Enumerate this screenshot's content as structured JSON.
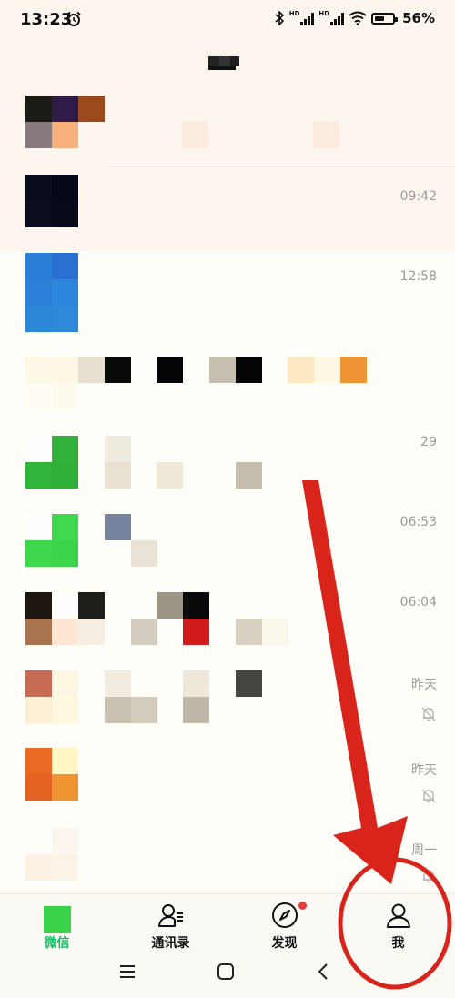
{
  "status_bar": {
    "time": "13:23",
    "alarm_icon": "alarm-clock-icon",
    "bluetooth_icon": "bluetooth-icon",
    "sim1_tag": "HD",
    "sim2_tag": "HD",
    "wifi_icon": "wifi-icon",
    "battery_level": 0.56,
    "battery_text": "56%"
  },
  "chat_list": {
    "rows": [
      {
        "time": "",
        "muted": false
      },
      {
        "time": "09:42",
        "muted": false
      },
      {
        "time": "12:58",
        "muted": false
      },
      {
        "time": "",
        "muted": false
      },
      {
        "time": "29",
        "muted": false
      },
      {
        "time": "06:53",
        "muted": false
      },
      {
        "time": "06:04",
        "muted": false
      },
      {
        "time": "昨天",
        "muted": true
      },
      {
        "time": "昨天",
        "muted": true
      },
      {
        "time": "周一",
        "muted": true
      }
    ]
  },
  "tab_bar": {
    "tabs": [
      {
        "label": "微信",
        "icon": "chat-icon",
        "active": true,
        "color": "#07c160"
      },
      {
        "label": "通讯录",
        "icon": "contacts-icon",
        "active": false
      },
      {
        "label": "发现",
        "icon": "compass-icon",
        "active": false,
        "badge": true
      },
      {
        "label": "我",
        "icon": "user-icon",
        "active": false
      }
    ]
  },
  "nav_bar": {
    "icons": [
      "menu-icon",
      "home-icon",
      "back-icon"
    ]
  },
  "annotation": {
    "color": "#d9241c",
    "shapes": [
      "arrow",
      "circle"
    ]
  }
}
